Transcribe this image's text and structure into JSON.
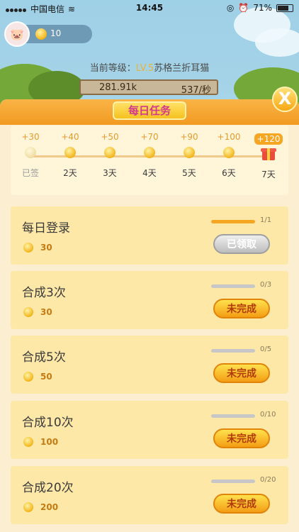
{
  "status_bar": {
    "carrier": "中国电信",
    "time": "14:45",
    "battery": "71%"
  },
  "player": {
    "coins": "10",
    "level_prefix": "当前等级：",
    "level": "LV.5",
    "level_name": "苏格兰折耳猫",
    "total": "281.91k",
    "rate": "537/秒"
  },
  "panel": {
    "title": "每日任务",
    "close_label": "X"
  },
  "signin": [
    {
      "reward": "+30",
      "day": "已签",
      "claimed": true
    },
    {
      "reward": "+40",
      "day": "2天",
      "claimed": false
    },
    {
      "reward": "+50",
      "day": "3天",
      "claimed": false
    },
    {
      "reward": "+70",
      "day": "4天",
      "claimed": false
    },
    {
      "reward": "+90",
      "day": "5天",
      "claimed": false
    },
    {
      "reward": "+100",
      "day": "6天",
      "claimed": false
    },
    {
      "reward": "+120",
      "day": "7天",
      "claimed": false,
      "gift": true
    }
  ],
  "tasks": [
    {
      "title": "每日登录",
      "reward": "30",
      "progress": "1/1",
      "ratio": 1.0,
      "button": "已领取",
      "state": "claimed"
    },
    {
      "title": "合成3次",
      "reward": "30",
      "progress": "0/3",
      "ratio": 0.0,
      "button": "未完成",
      "state": "todo"
    },
    {
      "title": "合成5次",
      "reward": "50",
      "progress": "0/5",
      "ratio": 0.0,
      "button": "未完成",
      "state": "todo"
    },
    {
      "title": "合成10次",
      "reward": "100",
      "progress": "0/10",
      "ratio": 0.0,
      "button": "未完成",
      "state": "todo"
    },
    {
      "title": "合成20次",
      "reward": "200",
      "progress": "0/20",
      "ratio": 0.0,
      "button": "未完成",
      "state": "todo"
    }
  ]
}
